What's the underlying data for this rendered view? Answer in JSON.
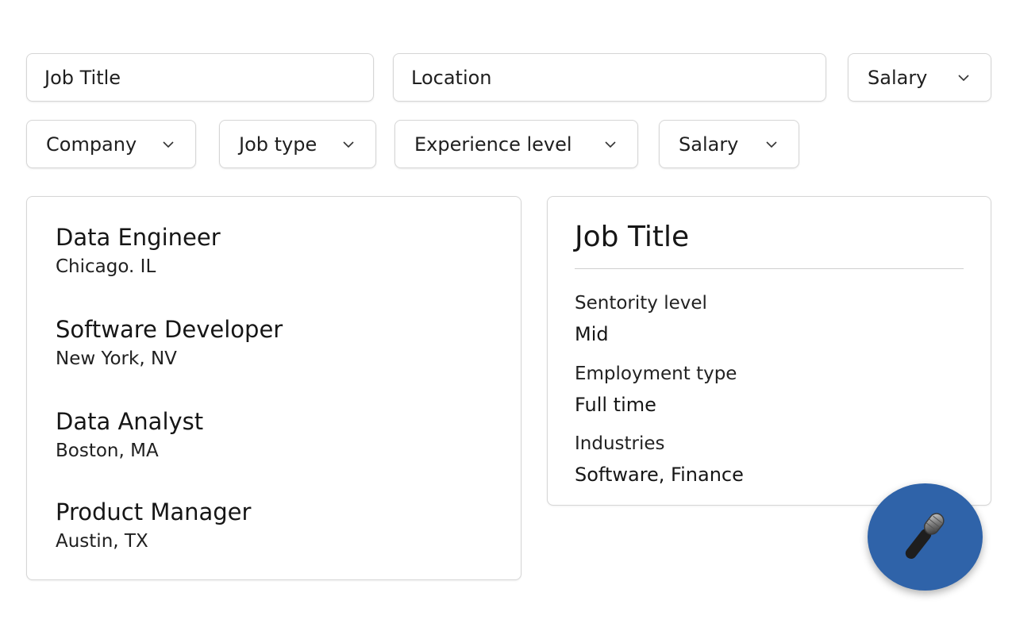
{
  "search": {
    "job_title_value": "Job Title",
    "location_value": "Location",
    "salary_label": "Salary"
  },
  "filters": [
    {
      "label": "Company"
    },
    {
      "label": "Job type"
    },
    {
      "label": "Experience level"
    },
    {
      "label": "Salary"
    }
  ],
  "jobs": [
    {
      "title": "Data Engineer",
      "location": "Chicago. IL"
    },
    {
      "title": "Software Developer",
      "location": "New York, NV"
    },
    {
      "title": "Data Analyst",
      "location": "Boston, MA"
    },
    {
      "title": "Product Manager",
      "location": "Austin, TX"
    }
  ],
  "detail": {
    "title": "Job Title",
    "fields": [
      {
        "label": "Sentority level",
        "value": "Mid"
      },
      {
        "label": "Employment type",
        "value": "Full time"
      },
      {
        "label": "Industries",
        "value": "Software, Finance"
      }
    ]
  },
  "fab": {
    "icon": "microphone-icon",
    "color": "#2f63a9"
  }
}
